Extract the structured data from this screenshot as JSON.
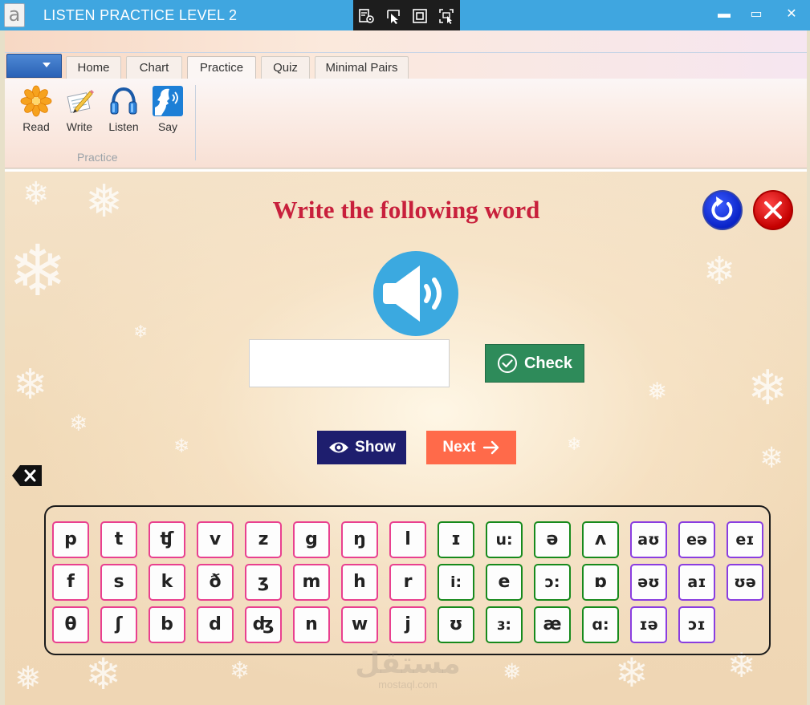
{
  "window": {
    "title": "LISTEN PRACTICE LEVEL 2",
    "app_icon_letter": "a",
    "controls": {
      "minimize": "▬",
      "maximize": "▭",
      "close": "✕"
    }
  },
  "ribbon": {
    "tabs": [
      {
        "label": "Home",
        "active": false
      },
      {
        "label": "Chart",
        "active": false
      },
      {
        "label": "Practice",
        "active": true
      },
      {
        "label": "Quiz",
        "active": false
      },
      {
        "label": "Minimal Pairs",
        "active": false
      }
    ],
    "group": {
      "label": "Practice",
      "items": [
        {
          "label": "Read",
          "icon": "flower-icon"
        },
        {
          "label": "Write",
          "icon": "pencil-paper-icon"
        },
        {
          "label": "Listen",
          "icon": "headphones-icon"
        },
        {
          "label": "Say",
          "icon": "speaking-face-icon"
        }
      ]
    }
  },
  "exercise": {
    "instruction": "Write the following word",
    "answer": {
      "value": "",
      "placeholder": ""
    },
    "check_label": "Check",
    "show_label": "Show",
    "next_label": "Next"
  },
  "keyboard": {
    "rows": [
      [
        {
          "symbol": "p",
          "type": "consonant"
        },
        {
          "symbol": "t",
          "type": "consonant"
        },
        {
          "symbol": "ʧ",
          "type": "consonant"
        },
        {
          "symbol": "v",
          "type": "consonant"
        },
        {
          "symbol": "z",
          "type": "consonant"
        },
        {
          "symbol": "g",
          "type": "consonant"
        },
        {
          "symbol": "ŋ",
          "type": "consonant"
        },
        {
          "symbol": "l",
          "type": "consonant"
        },
        {
          "symbol": "ɪ",
          "type": "vowel"
        },
        {
          "symbol": "u:",
          "type": "vowel"
        },
        {
          "symbol": "ə",
          "type": "vowel"
        },
        {
          "symbol": "ʌ",
          "type": "vowel"
        },
        {
          "symbol": "aʊ",
          "type": "diphthong"
        },
        {
          "symbol": "eə",
          "type": "diphthong"
        },
        {
          "symbol": "eɪ",
          "type": "diphthong"
        }
      ],
      [
        {
          "symbol": "f",
          "type": "consonant"
        },
        {
          "symbol": "s",
          "type": "consonant"
        },
        {
          "symbol": "k",
          "type": "consonant"
        },
        {
          "symbol": "ð",
          "type": "consonant"
        },
        {
          "symbol": "ʒ",
          "type": "consonant"
        },
        {
          "symbol": "m",
          "type": "consonant"
        },
        {
          "symbol": "h",
          "type": "consonant"
        },
        {
          "symbol": "r",
          "type": "consonant"
        },
        {
          "symbol": "i:",
          "type": "vowel"
        },
        {
          "symbol": "e",
          "type": "vowel"
        },
        {
          "symbol": "ɔ:",
          "type": "vowel"
        },
        {
          "symbol": "ɒ",
          "type": "vowel"
        },
        {
          "symbol": "əʊ",
          "type": "diphthong"
        },
        {
          "symbol": "aɪ",
          "type": "diphthong"
        },
        {
          "symbol": "ʊə",
          "type": "diphthong"
        }
      ],
      [
        {
          "symbol": "θ",
          "type": "consonant"
        },
        {
          "symbol": "ʃ",
          "type": "consonant"
        },
        {
          "symbol": "b",
          "type": "consonant"
        },
        {
          "symbol": "d",
          "type": "consonant"
        },
        {
          "symbol": "ʤ",
          "type": "consonant"
        },
        {
          "symbol": "n",
          "type": "consonant"
        },
        {
          "symbol": "w",
          "type": "consonant"
        },
        {
          "symbol": "j",
          "type": "consonant"
        },
        {
          "symbol": "ʊ",
          "type": "vowel"
        },
        {
          "symbol": "ɜ:",
          "type": "vowel"
        },
        {
          "symbol": "æ",
          "type": "vowel"
        },
        {
          "symbol": "ɑ:",
          "type": "vowel"
        },
        {
          "symbol": "ɪə",
          "type": "diphthong"
        },
        {
          "symbol": "ɔɪ",
          "type": "diphthong"
        }
      ]
    ]
  },
  "watermark": {
    "arabic": "مستقل",
    "latin": "mostaql.com"
  },
  "colors": {
    "titlebar": "#3fa6e0",
    "instruction": "#c8203c",
    "check": "#2e8b5a",
    "show": "#1e1e6e",
    "next": "#ff6a4a",
    "consonant_border": "#e9408f",
    "vowel_border": "#178a1c",
    "diphthong_border": "#8a3de0"
  }
}
